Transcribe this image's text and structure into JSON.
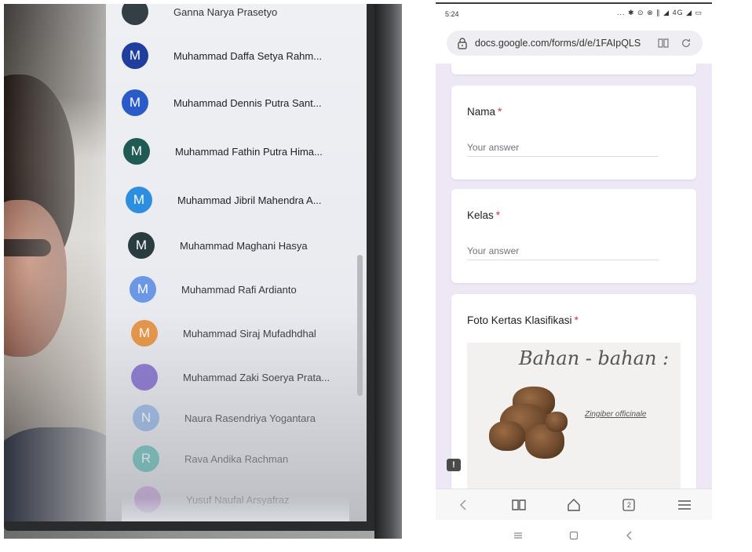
{
  "participants": {
    "items": [
      {
        "initial": "",
        "name": "Ganna Narya Prasetyo",
        "color": "#1f2b33"
      },
      {
        "initial": "M",
        "name": "Muhammad Daffa Setya Rahm...",
        "color": "#1f3e9e"
      },
      {
        "initial": "M",
        "name": "Muhammad Dennis Putra Sant...",
        "color": "#2a5bc9"
      },
      {
        "initial": "M",
        "name": "Muhammad Fathin Putra Hima...",
        "color": "#1f5a54"
      },
      {
        "initial": "M",
        "name": "Muhammad Jibril Mahendra A...",
        "color": "#2d8ee0"
      },
      {
        "initial": "M",
        "name": "Muhammad Maghani Hasya",
        "color": "#1f3337"
      },
      {
        "initial": "M",
        "name": "Muhammad Rafi Ardianto",
        "color": "#5f8fe6"
      },
      {
        "initial": "M",
        "name": "Muhammad Siraj Mufadhdhal",
        "color": "#e48a2f"
      },
      {
        "initial": "",
        "name": "Muhammad Zaki Soerya Prata...",
        "color": "#7b63c9"
      },
      {
        "initial": "N",
        "name": "Naura Rasendriya Yogantara",
        "color": "#7fa6df"
      },
      {
        "initial": "R",
        "name": "Rava Andika Rachman",
        "color": "#28a79e"
      },
      {
        "initial": "",
        "name": "Yusuf Naufal Arsyafraz",
        "color": "#a557c7"
      }
    ]
  },
  "phone": {
    "status": {
      "time": "5:24",
      "icons": "... ✱ ⊙ ⊗ ∥ ◢ 4G ◢ ▭"
    },
    "url": "docs.google.com/forms/d/e/1FAIpQLS",
    "form": {
      "q1": {
        "title": "Nama",
        "required": "*",
        "placeholder": "Your answer"
      },
      "q2": {
        "title": "Kelas",
        "required": "*",
        "placeholder": "Your answer"
      },
      "q3": {
        "title": "Foto Kertas Klasifikasi",
        "required": "*"
      },
      "photo": {
        "heading": "Bahan - bahan :",
        "label": "Zingiber officinale"
      }
    },
    "feedback_icon": "!",
    "tab_count": "2"
  },
  "colors": {
    "mute": "#d93447",
    "form_bg": "#ede7f6",
    "required": "#d93025"
  }
}
